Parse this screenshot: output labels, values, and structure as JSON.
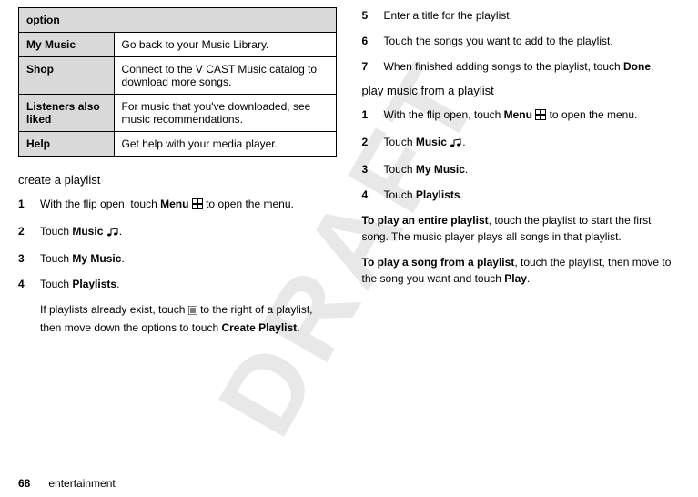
{
  "watermark": "DRAFT",
  "table": {
    "header": "option",
    "rows": [
      {
        "name": "My Music",
        "desc": "Go back to your Music Library."
      },
      {
        "name": "Shop",
        "desc": "Connect to the V CAST Music catalog to download more songs."
      },
      {
        "name": "Listeners also liked",
        "desc": "For music that you've downloaded, see music recommendations."
      },
      {
        "name": "Help",
        "desc": "Get help with your media player."
      }
    ]
  },
  "left": {
    "heading": "create a playlist",
    "steps": [
      {
        "n": "1",
        "pre": "With the flip open, touch ",
        "bold1": "Menu",
        "post1": " ",
        "icon": "grid",
        "post2": " to open the menu."
      },
      {
        "n": "2",
        "pre": "Touch ",
        "bold1": "Music",
        "post1": " ",
        "icon": "music",
        "post2": "."
      },
      {
        "n": "3",
        "pre": "Touch ",
        "bold1": "My Music",
        "post1": ".",
        "icon": "",
        "post2": ""
      },
      {
        "n": "4",
        "pre": "Touch ",
        "bold1": "Playlists",
        "post1": ".",
        "icon": "",
        "post2": ""
      }
    ],
    "note_pre": "If playlists already exist, touch ",
    "note_icon": "menu",
    "note_mid": " to the right of a playlist, then move down the options to touch ",
    "note_bold": "Create Playlist",
    "note_post": "."
  },
  "right": {
    "steps": [
      {
        "n": "5",
        "pre": "Enter a title for the playlist."
      },
      {
        "n": "6",
        "pre": "Touch the songs you want to add to the playlist."
      },
      {
        "n": "7",
        "pre": "When finished adding songs to the playlist, touch ",
        "bold1": "Done",
        "post1": "."
      }
    ],
    "heading": "play music from a playlist",
    "steps2": [
      {
        "n": "1",
        "pre": "With the flip open, touch ",
        "bold1": "Menu",
        "post1": " ",
        "icon": "grid",
        "post2": " to open the menu."
      },
      {
        "n": "2",
        "pre": "Touch ",
        "bold1": "Music",
        "post1": " ",
        "icon": "music",
        "post2": "."
      },
      {
        "n": "3",
        "pre": "Touch ",
        "bold1": "My Music",
        "post1": ".",
        "icon": "",
        "post2": ""
      },
      {
        "n": "4",
        "pre": "Touch ",
        "bold1": "Playlists",
        "post1": ".",
        "icon": "",
        "post2": ""
      }
    ],
    "para1_bold": "To play an entire playlist",
    "para1_rest": ", touch the playlist to start the first song. The music player plays all songs in that playlist.",
    "para2_bold": "To play a song from a playlist",
    "para2_rest": ", touch the playlist, then move to the song you want and touch ",
    "para2_bold2": "Play",
    "para2_post": "."
  },
  "footer": {
    "page": "68",
    "section": "entertainment"
  }
}
